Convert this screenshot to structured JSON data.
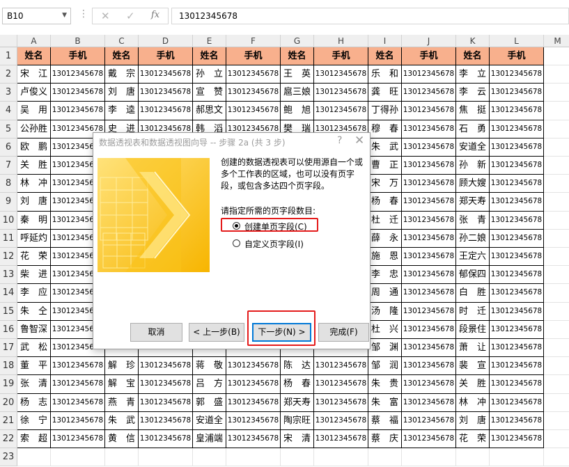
{
  "formula_bar": {
    "name_box": "B10",
    "cancel_icon": "✕",
    "enter_icon": "✓",
    "fx_label": "fx",
    "content": "13012345678"
  },
  "sheet": {
    "columns": [
      "A",
      "B",
      "C",
      "D",
      "E",
      "F",
      "G",
      "H",
      "I",
      "J",
      "K",
      "L",
      "M"
    ],
    "rows": [
      "1",
      "2",
      "3",
      "4",
      "5",
      "6",
      "7",
      "8",
      "9",
      "10",
      "11",
      "12",
      "13",
      "14",
      "15",
      "16",
      "17",
      "18",
      "19",
      "20",
      "21",
      "22",
      "23"
    ],
    "table": [
      [
        "姓名",
        "手机",
        "姓名",
        "手机",
        "姓名",
        "手机",
        "姓名",
        "手机",
        "姓名",
        "手机",
        "姓名",
        "手机"
      ],
      [
        "宋　江",
        "13012345678",
        "戴　宗",
        "13012345678",
        "孙　立",
        "13012345678",
        "王　英",
        "13012345678",
        "乐　和",
        "13012345678",
        "李　立",
        "13012345678"
      ],
      [
        "卢俊义",
        "13012345678",
        "刘　唐",
        "13012345678",
        "宣　赞",
        "13012345678",
        "扈三娘",
        "13012345678",
        "龚　旺",
        "13012345678",
        "李　云",
        "13012345678"
      ],
      [
        "吴　用",
        "13012345678",
        "李　逵",
        "13012345678",
        "郝思文",
        "13012345678",
        "鲍　旭",
        "13012345678",
        "丁得孙",
        "13012345678",
        "焦　挺",
        "13012345678"
      ],
      [
        "公孙胜",
        "13012345678",
        "史　进",
        "13012345678",
        "韩　滔",
        "13012345678",
        "樊　瑞",
        "13012345678",
        "穆　春",
        "13012345678",
        "石　勇",
        "13012345678"
      ],
      [
        "欧　鹏",
        "13012345678",
        "",
        "",
        "",
        "",
        "",
        "",
        "朱　武",
        "13012345678",
        "安道全",
        "13012345678"
      ],
      [
        "关　胜",
        "13012345678",
        "",
        "",
        "",
        "",
        "",
        "",
        "曹　正",
        "13012345678",
        "孙　新",
        "13012345678"
      ],
      [
        "林　冲",
        "13012345678",
        "",
        "",
        "",
        "",
        "",
        "",
        "宋　万",
        "13012345678",
        "顾大嫂",
        "13012345678"
      ],
      [
        "刘　唐",
        "13012345678",
        "",
        "",
        "",
        "",
        "",
        "",
        "杨　春",
        "13012345678",
        "郑天寿",
        "13012345678"
      ],
      [
        "秦　明",
        "13012345678",
        "",
        "",
        "",
        "",
        "",
        "",
        "杜　迁",
        "13012345678",
        "张　青",
        "13012345678"
      ],
      [
        "呼延灼",
        "13012345678",
        "",
        "",
        "",
        "",
        "",
        "",
        "薛　永",
        "13012345678",
        "孙二娘",
        "13012345678"
      ],
      [
        "花　荣",
        "13012345678",
        "",
        "",
        "",
        "",
        "",
        "",
        "施　恩",
        "13012345678",
        "王定六",
        "13012345678"
      ],
      [
        "柴　进",
        "13012345678",
        "",
        "",
        "",
        "",
        "",
        "",
        "李　忠",
        "13012345678",
        "郁保四",
        "13012345678"
      ],
      [
        "李　应",
        "13012345678",
        "",
        "",
        "",
        "",
        "",
        "",
        "周　通",
        "13012345678",
        "白　胜",
        "13012345678"
      ],
      [
        "朱　仝",
        "13012345678",
        "",
        "",
        "",
        "",
        "",
        "",
        "汤　隆",
        "13012345678",
        "时　迁",
        "13012345678"
      ],
      [
        "鲁智深",
        "13012345678",
        "",
        "",
        "",
        "",
        "",
        "",
        "杜　兴",
        "13012345678",
        "段景住",
        "13012345678"
      ],
      [
        "武　松",
        "13012345678",
        "",
        "",
        "",
        "",
        "",
        "",
        "邹　渊",
        "13012345678",
        "萧　让",
        "13012345678"
      ],
      [
        "董　平",
        "13012345678",
        "解　珍",
        "13012345678",
        "蒋　敬",
        "13012345678",
        "陈　达",
        "13012345678",
        "邹　润",
        "13012345678",
        "裴　宣",
        "13012345678"
      ],
      [
        "张　清",
        "13012345678",
        "解　宝",
        "13012345678",
        "吕　方",
        "13012345678",
        "杨　春",
        "13012345678",
        "朱　贵",
        "13012345678",
        "关　胜",
        "13012345678"
      ],
      [
        "杨　志",
        "13012345678",
        "燕　青",
        "13012345678",
        "郭　盛",
        "13012345678",
        "郑天寿",
        "13012345678",
        "朱　富",
        "13012345678",
        "林　冲",
        "13012345678"
      ],
      [
        "徐　宁",
        "13012345678",
        "朱　武",
        "13012345678",
        "安道全",
        "13012345678",
        "陶宗旺",
        "13012345678",
        "蔡　福",
        "13012345678",
        "刘　唐",
        "13012345678"
      ],
      [
        "索　超",
        "13012345678",
        "黄　信",
        "13012345678",
        "皇浦端",
        "13012345678",
        "宋　清",
        "13012345678",
        "蔡　庆",
        "13012345678",
        "花　荣",
        "13012345678"
      ]
    ],
    "header_fill_color": "#f8b08d"
  },
  "dialog": {
    "title": "数据透视表和数据透视图向导 -- 步骤 2a (共 3 步)",
    "help_icon": "?",
    "close_icon": "✕",
    "description": "创建的数据透视表可以使用源自一个或多个工作表的区域，也可以没有页字段，或包含多达四个页字段。",
    "prompt": "请指定所需的页字段数目:",
    "options": [
      {
        "label": "创建单页字段(C)",
        "selected": true
      },
      {
        "label": "自定义页字段(I)",
        "selected": false
      }
    ],
    "buttons": {
      "cancel": "取消",
      "back": "< 上一步(B)",
      "next": "下一步(N) >",
      "finish": "完成(F)"
    },
    "highlight_color": "#e41b1b"
  }
}
